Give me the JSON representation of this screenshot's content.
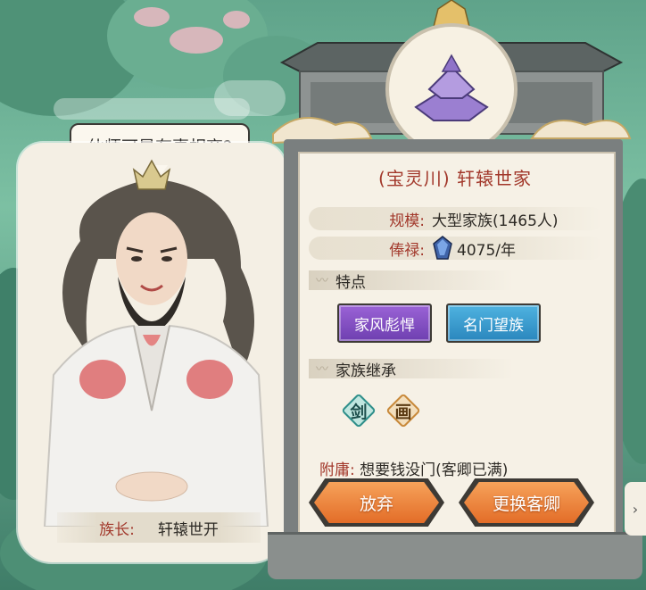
{
  "speech_bubble": "仙师可是有事相商?",
  "leader": {
    "label": "族长:",
    "name": "轩辕世开"
  },
  "clan": {
    "title": "(宝灵川) 轩辕世家",
    "scale_label": "规模:",
    "scale_value": "大型家族(1465人)",
    "salary_label": "俸禄:",
    "salary_value": "4075/年",
    "salary_icon": "spirit-stone-icon"
  },
  "traits": {
    "heading": "特点",
    "items": [
      {
        "label": "家风彪悍",
        "color": "#7d4ac2"
      },
      {
        "label": "名门望族",
        "color": "#3599cf"
      }
    ]
  },
  "inheritance": {
    "heading": "家族继承",
    "skills": [
      {
        "glyph": "剑",
        "icon": "sword-skill-icon",
        "color": "#2f8f8a"
      },
      {
        "glyph": "画",
        "icon": "painting-skill-icon",
        "color": "#c8893a"
      }
    ]
  },
  "retainer": {
    "label": "附庸:",
    "value": "想要钱没门(客卿已满)"
  },
  "buttons": {
    "abandon": "放弃",
    "replace": "更换客卿"
  }
}
